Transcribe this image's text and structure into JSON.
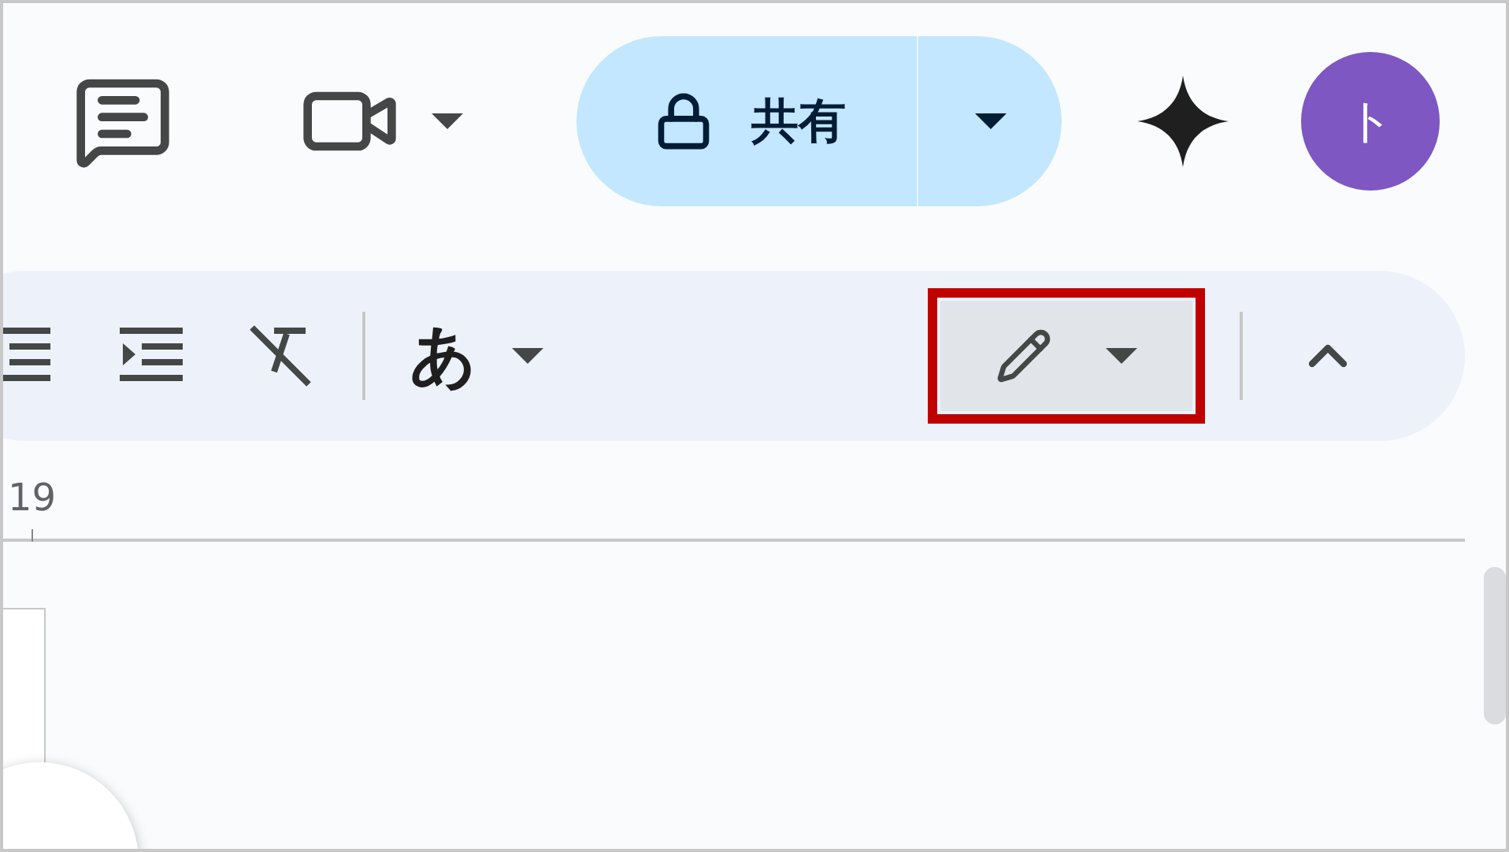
{
  "top_bar": {
    "share_button": {
      "label": "共有"
    },
    "avatar": {
      "initial": "ト"
    }
  },
  "toolbar": {
    "input_mode_button": {
      "label": "あ"
    },
    "edit_mode_button": {
      "highlighted": true
    }
  },
  "ruler": {
    "label": "19"
  }
}
